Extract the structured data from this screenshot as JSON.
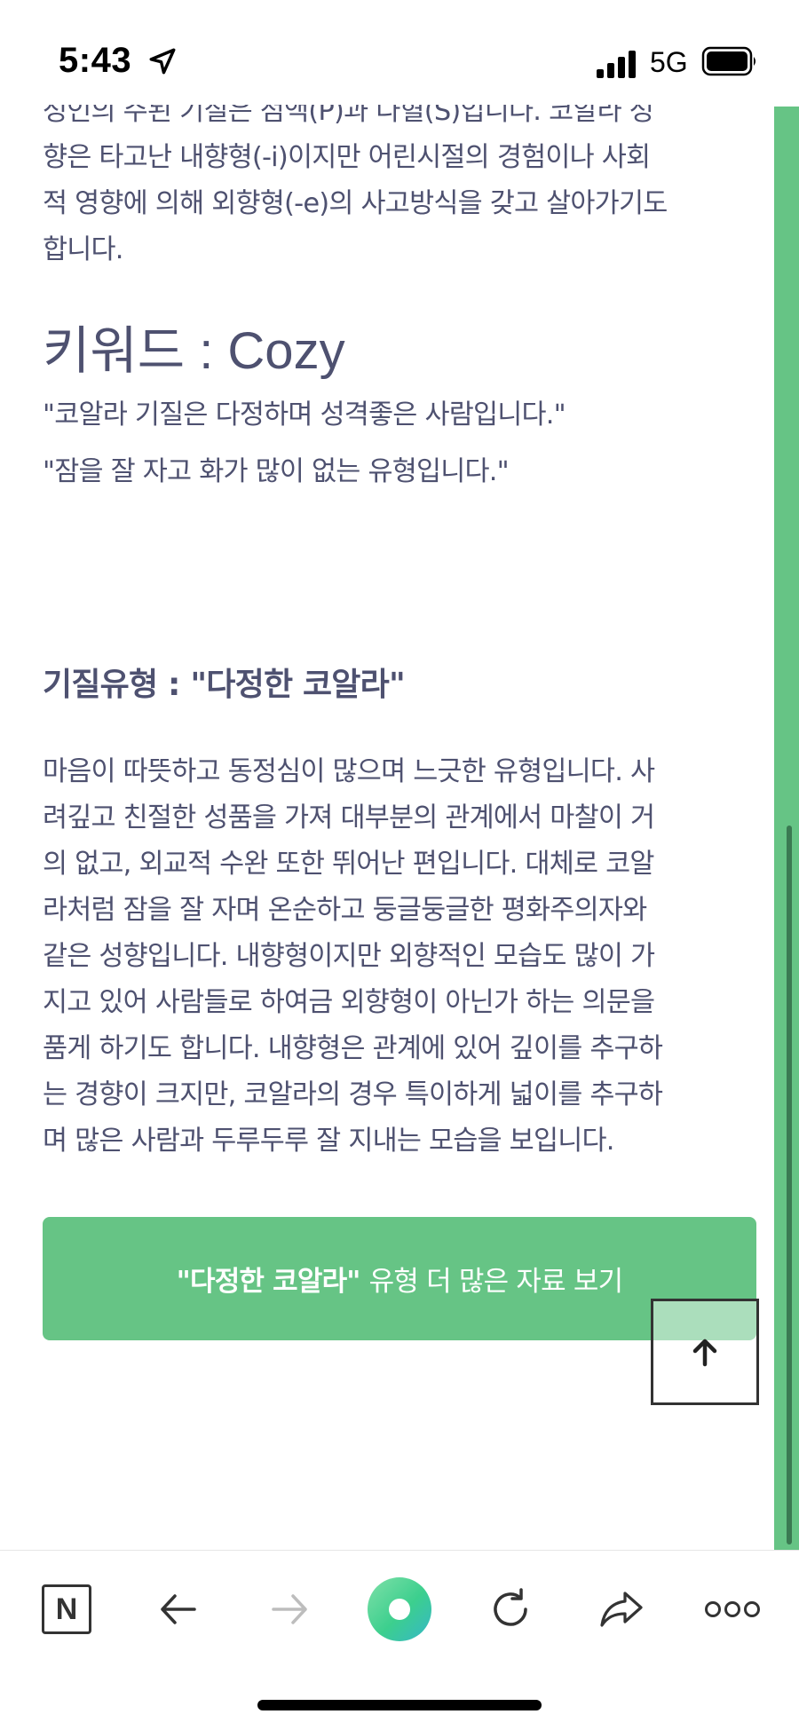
{
  "status_bar": {
    "time": "5:43",
    "network": "5G"
  },
  "article": {
    "intro_lines": [
      "성인의 주된 기질은 점액(P)과 다혈(S)입니다. 코알라 성",
      "향은 타고난 내향형(-i)이지만 어린시절의 경험이나 사회",
      "적 영향에 의해 외향형(-e)의 사고방식을 갖고 살아가기도",
      "합니다."
    ],
    "keyword_heading": "키워드 : Cozy",
    "quotes": [
      "\"코알라 기질은 다정하며 성격좋은 사람입니다.\"",
      "\"잠을 잘 자고 화가 많이 없는 유형입니다.\""
    ],
    "type_heading": "기질유형 : \"다정한 코알라\"",
    "description_lines": [
      "마음이 따뜻하고 동정심이 많으며 느긋한 유형입니다. 사",
      "려깊고 친절한 성품을 가져 대부분의 관계에서 마찰이 거",
      "의 없고, 외교적 수완 또한 뛰어난 편입니다. 대체로 코알",
      "라처럼 잠을 잘 자며 온순하고 둥글둥글한 평화주의자와",
      "같은 성향입니다. 내향형이지만 외향적인 모습도 많이 가",
      "지고 있어 사람들로 하여금 외향형이 아닌가 하는 의문을",
      "품게 하기도 합니다. 내향형은 관계에 있어 깊이를 추구하",
      "는 경향이 크지만, 코알라의 경우 특이하게 넓이를 추구하",
      "며 많은 사람과 두루두루 잘 지내는 모습을 보입니다."
    ],
    "more_button": {
      "bold": "\"다정한 코알라\"",
      "rest": "유형 더 많은 자료 보기"
    }
  },
  "toolbar": {
    "logo_letter": "N",
    "icons": [
      "naver-logo-icon",
      "back-arrow-icon",
      "forward-arrow-icon",
      "home-icon",
      "reload-icon",
      "share-icon",
      "more-icon"
    ]
  },
  "colors": {
    "accent_green": "#66c485",
    "text": "#4e5170"
  }
}
